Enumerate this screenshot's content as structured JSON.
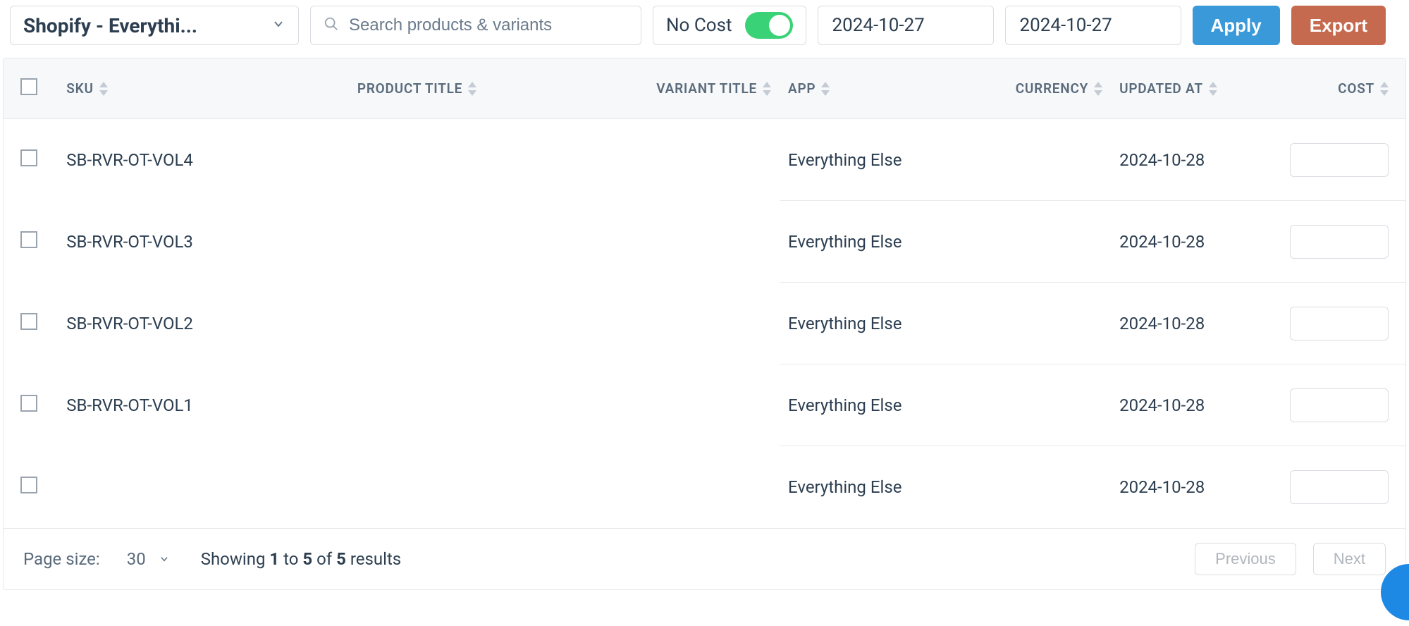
{
  "toolbar": {
    "store_selector": "Shopify - Everythi...",
    "search_placeholder": "Search products & variants",
    "no_cost_label": "No Cost",
    "no_cost_on": true,
    "date_from": "2024-10-27",
    "date_to": "2024-10-27",
    "apply_label": "Apply",
    "export_label": "Export"
  },
  "columns": {
    "sku": "SKU",
    "product_title": "PRODUCT TITLE",
    "variant_title": "VARIANT TITLE",
    "app": "APP",
    "currency": "CURRENCY",
    "updated_at": "UPDATED AT",
    "cost": "COST"
  },
  "rows": [
    {
      "sku": "SB-RVR-OT-VOL4",
      "product_title": "",
      "variant_title": "",
      "app": "Everything Else",
      "currency": "",
      "updated_at": "2024-10-28",
      "cost": ""
    },
    {
      "sku": "SB-RVR-OT-VOL3",
      "product_title": "",
      "variant_title": "",
      "app": "Everything Else",
      "currency": "",
      "updated_at": "2024-10-28",
      "cost": ""
    },
    {
      "sku": "SB-RVR-OT-VOL2",
      "product_title": "",
      "variant_title": "",
      "app": "Everything Else",
      "currency": "",
      "updated_at": "2024-10-28",
      "cost": ""
    },
    {
      "sku": "SB-RVR-OT-VOL1",
      "product_title": "",
      "variant_title": "",
      "app": "Everything Else",
      "currency": "",
      "updated_at": "2024-10-28",
      "cost": ""
    },
    {
      "sku": "",
      "product_title": "",
      "variant_title": "",
      "app": "Everything Else",
      "currency": "",
      "updated_at": "2024-10-28",
      "cost": ""
    }
  ],
  "footer": {
    "page_size_label": "Page size:",
    "page_size_value": "30",
    "showing_prefix": "Showing",
    "from": "1",
    "to_word": "to",
    "to": "5",
    "of_word": "of",
    "total": "5",
    "results_word": "results",
    "prev_label": "Previous",
    "next_label": "Next"
  }
}
